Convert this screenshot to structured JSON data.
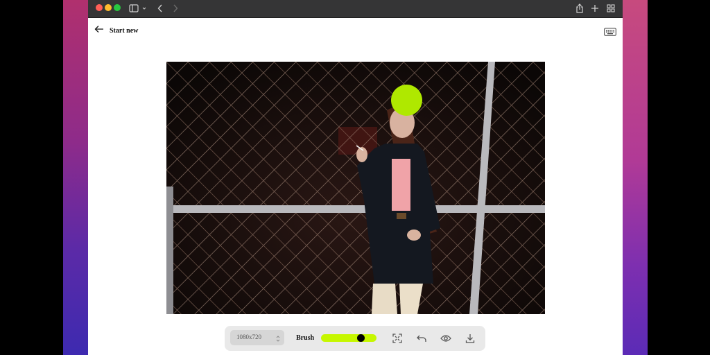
{
  "header": {
    "back_label": "Start new"
  },
  "toolbar": {
    "resolution": "1080x720",
    "brush_label": "Brush",
    "brush_size_fraction": 0.75
  },
  "colors": {
    "accent": "#c6f700",
    "brush_fill": "#afe800"
  },
  "icons": {
    "back": "arrow-left-icon",
    "keyboard": "keyboard-icon",
    "fit": "expand-icon",
    "undo": "undo-icon",
    "preview": "eye-icon",
    "download": "download-icon"
  }
}
